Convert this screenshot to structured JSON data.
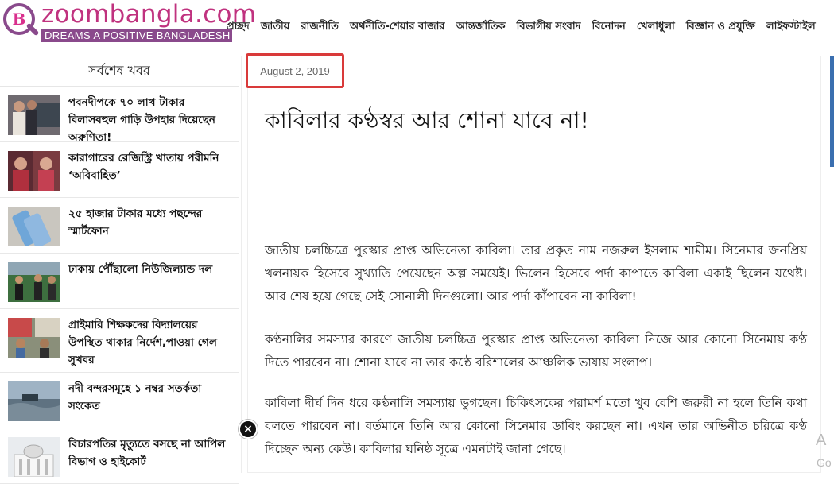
{
  "header": {
    "logo_text": "zoombangla.com",
    "logo_tagline": "DREAMS A POSITIVE BANGLADESH",
    "nav": [
      "প্রচ্ছদ",
      "জাতীয়",
      "রাজনীতি",
      "অর্থনীতি-শেয়ার বাজার",
      "আন্তর্জাতিক",
      "বিভাগীয় সংবাদ",
      "বিনোদন",
      "খেলাধুলা",
      "বিজ্ঞান ও প্রযুক্তি",
      "লাইফস্টাইল"
    ]
  },
  "sidebar": {
    "title": "সর্বশেষ খবর",
    "items": [
      {
        "title": "পবনদীপকে ৭০ লাখ টাকার বিলাসবহুল গাড়ি উপহার দিয়েছেন অরুণিতা!"
      },
      {
        "title": "কারাগারের রেজিস্ট্রি খাতায় পরীমনি ‘অবিবাহিত’"
      },
      {
        "title": "২৫ হাজার টাকার মধ্যে পছন্দের স্মার্টফোন"
      },
      {
        "title": "ঢাকায় পৌঁছালো নিউজিল্যান্ড দল"
      },
      {
        "title": "প্রাইমারি শিক্ষকদের বিদ্যালয়ের উপস্থিত থাকার নির্দেশ,পাওয়া গেল সুখবর"
      },
      {
        "title": "নদী বন্দরসমূহে ১ নম্বর সতর্কতা সংকেত"
      },
      {
        "title": "বিচারপতির মৃত্যুতে বসছে না আপিল বিভাগ ও হাইকোর্ট"
      }
    ]
  },
  "article": {
    "date": "August 2, 2019",
    "headline": "কাবিলার কণ্ঠস্বর আর শোনা যাবে না!",
    "paragraphs": [
      "জাতীয় চলচ্চিত্রে পুরস্কার প্রাপ্ত অভিনেতা কাবিলা। তার প্রকৃত নাম নজরুল ইসলাম শামীম। সিনেমার জনপ্রিয় খলনায়ক হিসেবে সুখ্যাতি পেয়েছেন অল্প সময়েই। ভিলেন হিসেবে পর্দা কাপাতে কাবিলা একাই ছিলেন যথেষ্ট। আর শেষ হয়ে গেছে সেই সোনালী দিনগুলো। আর পর্দা কাঁপাবেন না কাবিলা!",
      "কণ্ঠনালির সমস্যার কারণে জাতীয় চলচ্চিত্র পুরস্কার প্রাপ্ত অভিনেতা কাবিলা নিজে আর কোনো সিনেমায় কণ্ঠ দিতে পারবেন না। শোনা যাবে না তার কণ্ঠে বরিশালের আঞ্চলিক ভাষায় সংলাপ।",
      "কাবিলা দীর্ঘ দিন ধরে কণ্ঠনালি সমস্যায় ভুগছেন। চিকিৎসকের পরামর্শ মতো খুব বেশি জরুরী না হলে তিনি কথা বলতে পারবেন না। বর্তমানে তিনি আর কোনো সিনেমার ডাবিং করছেন না। এখন তার অভিনীত চরিত্রে কণ্ঠ দিচ্ছেন অন্য কেউ। কাবিলার ঘনিষ্ঠ সূত্রে এমনটাই জানা গেছে।"
    ]
  },
  "edge_text": {
    "line1": "A",
    "line2": "Go"
  },
  "close_glyph": "×",
  "colors": {
    "brand_magenta": "#c0327f",
    "brand_purple": "#8a4a8c",
    "date_highlight": "#d93a3a"
  }
}
